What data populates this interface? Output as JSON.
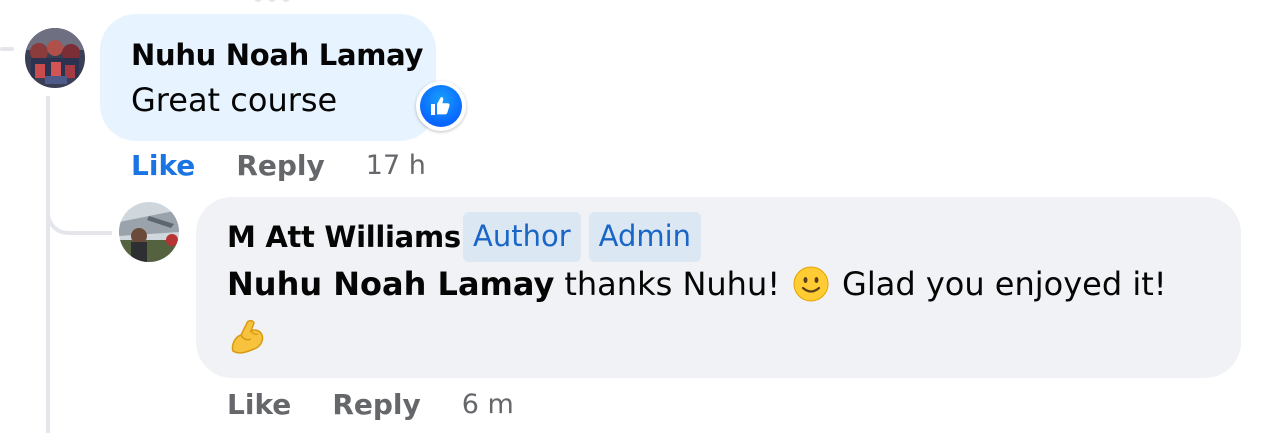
{
  "comment": {
    "author": "Nuhu Noah Lamay",
    "text": "Great course",
    "reaction_icon": "thumbs-up-icon",
    "actions": {
      "like_label": "Like",
      "reply_label": "Reply",
      "timestamp": "17 h"
    },
    "liked": true,
    "like_color": "#1b74e4"
  },
  "reply": {
    "author": "M Att Williams",
    "badges": [
      "Author",
      "Admin"
    ],
    "mention": "Nuhu Noah Lamay",
    "text_part1": "thanks Nuhu!",
    "emoji1": "slightly-smiling-face-emoji",
    "text_part2": "Glad you enjoyed it!",
    "emoji2": "flexed-biceps-emoji",
    "actions": {
      "like_label": "Like",
      "reply_label": "Reply",
      "timestamp": "6 m"
    }
  },
  "colors": {
    "comment_bubble": "#e7f3ff",
    "reply_bubble": "#f0f2f5",
    "badge_bg": "#dbe7f2",
    "badge_text": "#1a66c7",
    "secondary_text": "#65676b"
  }
}
